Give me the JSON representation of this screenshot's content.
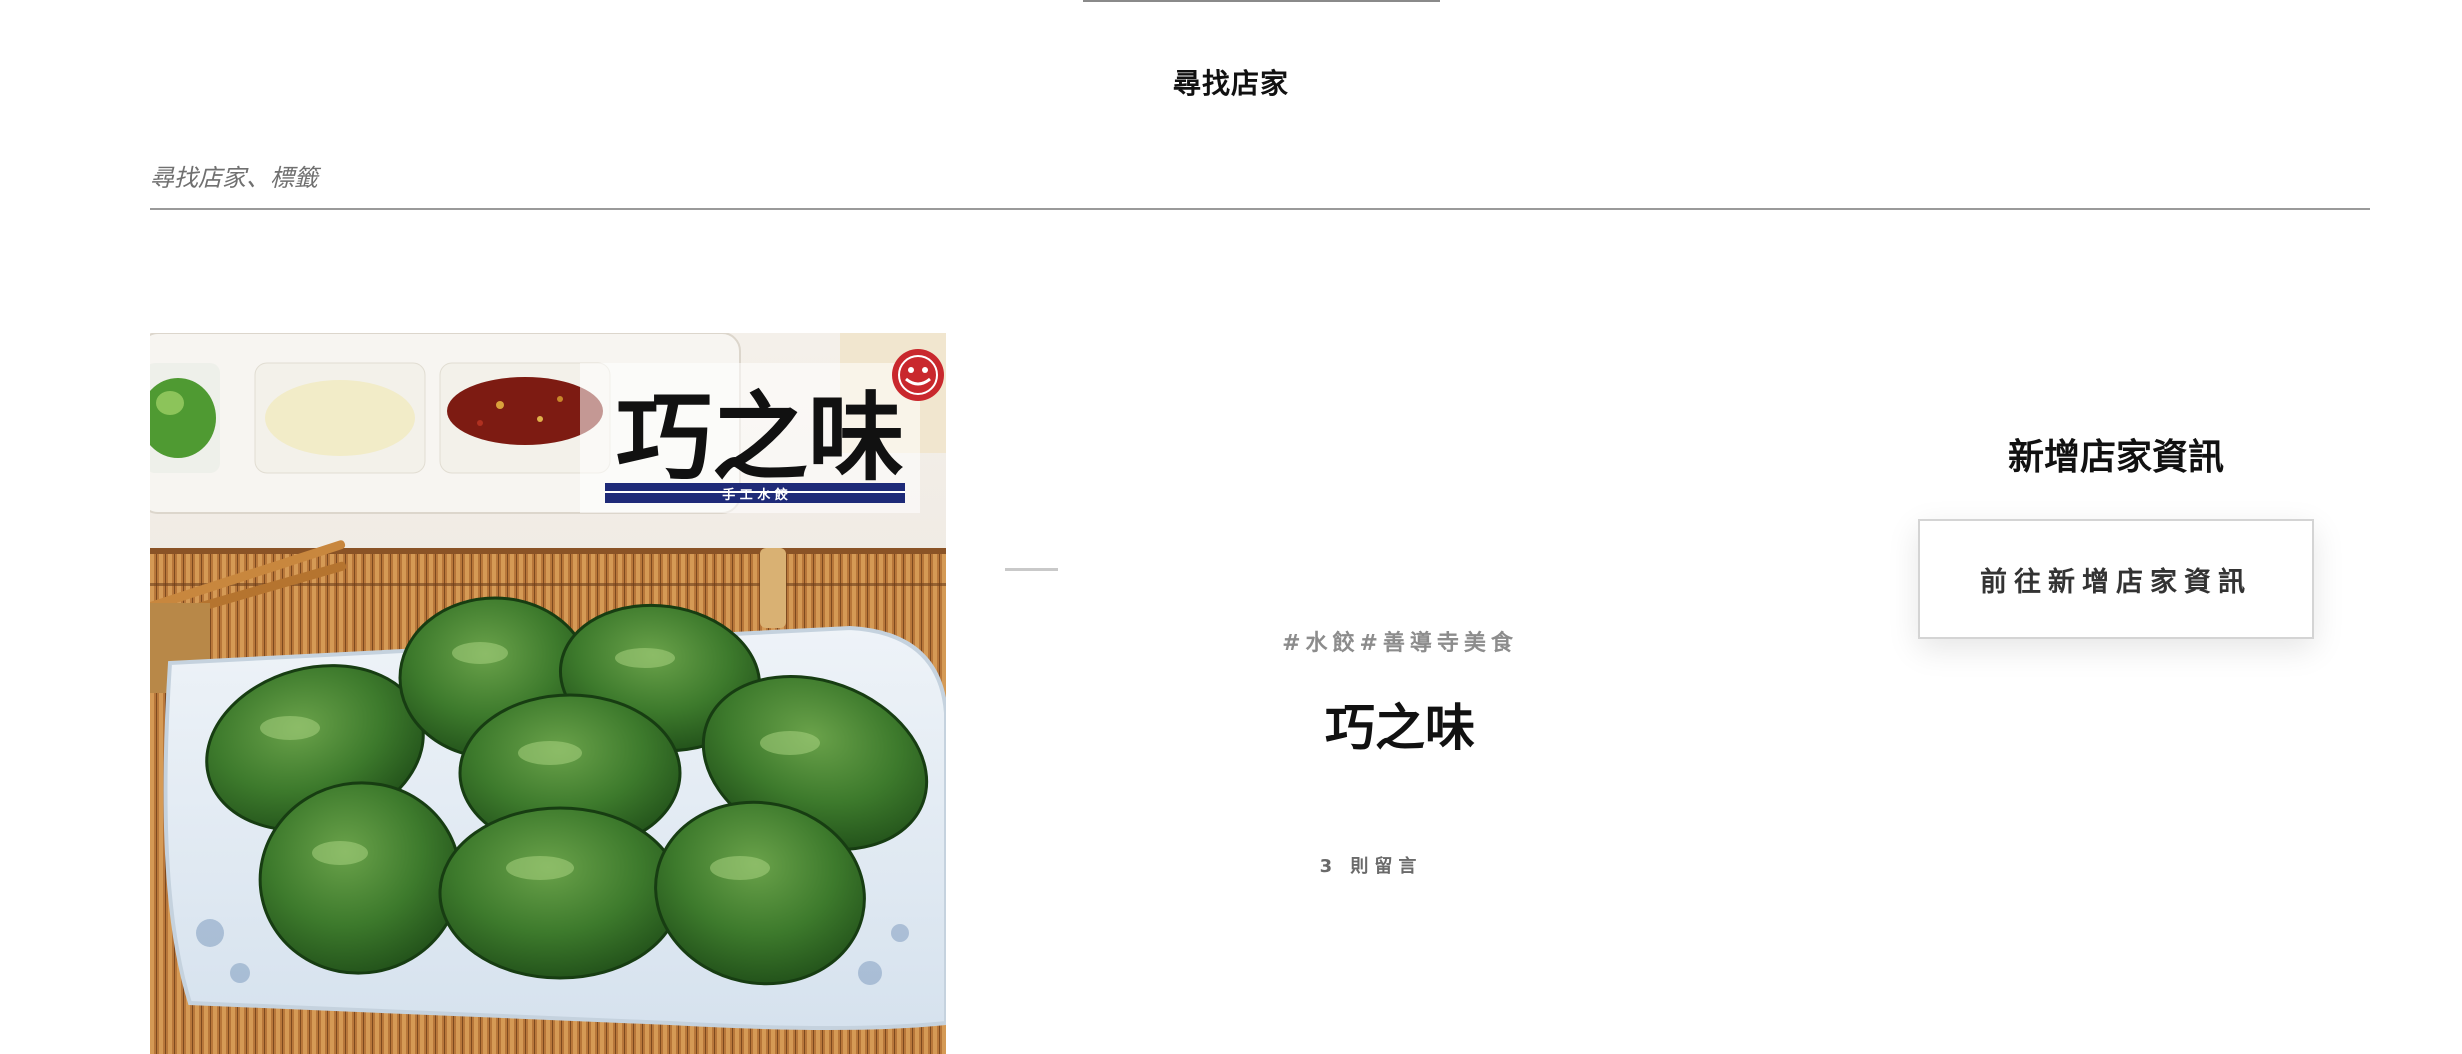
{
  "search": {
    "title": "尋找店家",
    "placeholder": "尋找店家、標籤",
    "value": ""
  },
  "store": {
    "image_alt": "巧之味 手工水餃",
    "logo_text": "巧之味",
    "logo_subtitle": "手 工 水 餃",
    "tags": [
      "#水餃",
      "#善導寺美食"
    ],
    "name": "巧之味",
    "comments": "3 則留言"
  },
  "add_store": {
    "title": "新增店家資訊",
    "button_label": "前往新增店家資訊"
  },
  "colors": {
    "accent_navy": "#1e2a78",
    "logo_red": "#c9282d",
    "dumpling_green": "#3e7a2e",
    "text_muted": "#8c8c8c"
  }
}
